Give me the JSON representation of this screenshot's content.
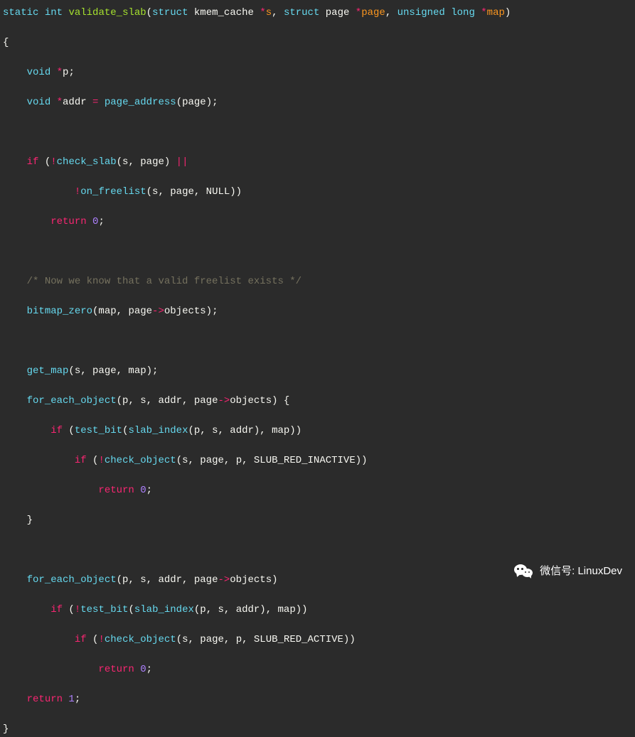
{
  "code": {
    "l1": {
      "static": "static",
      "int": "int",
      "fn": "validate_slab",
      "struct1": "struct",
      "type1": "kmem_cache",
      "star": "*",
      "s": "s",
      "comma": ", ",
      "struct2": "struct",
      "type2": "page",
      "page": "page",
      "unsigned": "unsigned",
      "long": "long",
      "map": "map",
      "close": ")"
    },
    "l2": "{",
    "l3": {
      "void": "void",
      "star": "*",
      "p": "p",
      "semi": ";"
    },
    "l4": {
      "void": "void",
      "star": "*",
      "addr": "addr",
      "eq": " = ",
      "fn": "page_address",
      "open": "(",
      "page": "page",
      "close": ");"
    },
    "l5": {
      "if": "if",
      "open": " (",
      "not": "!",
      "fn": "check_slab",
      "args": "(s, page) ",
      "or": "||"
    },
    "l6": {
      "not": "!",
      "fn": "on_freelist",
      "args": "(s, page, NULL))"
    },
    "l7": {
      "return": "return",
      "val": " 0",
      "semi": ";"
    },
    "l8": {
      "comment": "/* Now we know that a valid freelist exists */"
    },
    "l9": {
      "fn": "bitmap_zero",
      "open": "(map, page",
      "arrow": "->",
      "objects": "objects",
      "close": ");"
    },
    "l10": {
      "fn": "get_map",
      "args": "(s, page, map);"
    },
    "l11": {
      "fn": "for_each_object",
      "args1": "(p, s, addr, page",
      "arrow": "->",
      "objects": "objects",
      "args2": ") {"
    },
    "l12": {
      "if": "if",
      "open": " (",
      "fn": "test_bit",
      "open2": "(",
      "fn2": "slab_index",
      "args": "(p, s, addr), map))"
    },
    "l13": {
      "if": "if",
      "open": " (",
      "not": "!",
      "fn": "check_object",
      "args": "(s, page, p, SLUB_RED_INACTIVE))"
    },
    "l14": {
      "return": "return",
      "val": " 0",
      "semi": ";"
    },
    "l15": "    }",
    "l16": {
      "fn": "for_each_object",
      "args1": "(p, s, addr, page",
      "arrow": "->",
      "objects": "objects",
      "args2": ")"
    },
    "l17": {
      "if": "if",
      "open": " (",
      "not": "!",
      "fn": "test_bit",
      "open2": "(",
      "fn2": "slab_index",
      "args": "(p, s, addr), map))"
    },
    "l18": {
      "if": "if",
      "open": " (",
      "not": "!",
      "fn": "check_object",
      "args": "(s, page, p, SLUB_RED_ACTIVE))"
    },
    "l19": {
      "return": "return",
      "val": " 0",
      "semi": ";"
    },
    "l20": {
      "return": "return",
      "val": " 1",
      "semi": ";"
    },
    "l21": "}"
  },
  "watermark": {
    "label": "微信号",
    "value": "LinuxDev"
  }
}
